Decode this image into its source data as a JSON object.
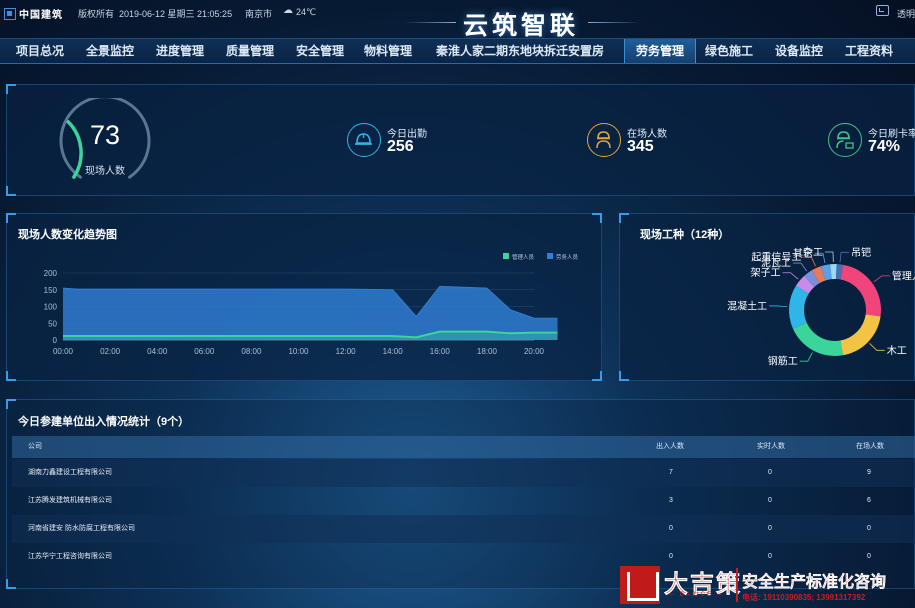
{
  "header": {
    "company": "中国建筑",
    "copyright": "版权所有",
    "datetime": "2019-06-12 星期三 21:05:25",
    "city": "南京市",
    "temperature": "24℃",
    "app_title": "云筑智联",
    "right_label": "透明"
  },
  "nav": {
    "items": [
      "项目总况",
      "全景监控",
      "进度管理",
      "质量管理",
      "安全管理",
      "物料管理"
    ],
    "project": "秦淮人家二期东地块拆迁安置房",
    "active": "劳务管理",
    "items_right": [
      "绿色施工",
      "设备监控",
      "工程资料"
    ]
  },
  "summary": {
    "onsite_count": "73",
    "onsite_label": "现场人数",
    "onsite_ratio": 0.29,
    "stats": [
      {
        "label": "今日出勤",
        "value": "256",
        "color": "#2fb5e8",
        "icon": "helmet-icon"
      },
      {
        "label": "在场人数",
        "value": "345",
        "color": "#e8a53a",
        "icon": "worker-icon"
      },
      {
        "label": "今日刷卡率",
        "value": "74%",
        "color": "#3cc48a",
        "icon": "card-worker-icon"
      }
    ]
  },
  "trend": {
    "title": "现场人数变化趋势图"
  },
  "chart_data": [
    {
      "type": "area",
      "title": "现场人数变化趋势图",
      "x": [
        "00:00",
        "02:00",
        "04:00",
        "06:00",
        "08:00",
        "10:00",
        "12:00",
        "14:00",
        "16:00",
        "18:00",
        "20:00"
      ],
      "ylim": [
        0,
        200
      ],
      "yticks": [
        0,
        50,
        100,
        150,
        200
      ],
      "legend": {
        "position": "top-right"
      },
      "series": [
        {
          "name": "管理人员",
          "color": "#3bd49a",
          "points": [
            [
              0,
              12
            ],
            [
              1,
              12
            ],
            [
              2,
              12
            ],
            [
              3,
              12
            ],
            [
              4,
              12
            ],
            [
              5,
              12
            ],
            [
              6,
              12
            ],
            [
              7,
              12
            ],
            [
              7.5,
              8
            ],
            [
              8,
              25
            ],
            [
              9,
              25
            ],
            [
              9.5,
              20
            ],
            [
              10,
              22
            ],
            [
              10.5,
              22
            ]
          ]
        },
        {
          "name": "劳务人员",
          "color": "#2f7fd6",
          "points": [
            [
              0,
              155
            ],
            [
              0.3,
              152
            ],
            [
              1,
              152
            ],
            [
              2,
              152
            ],
            [
              3,
              152
            ],
            [
              4,
              152
            ],
            [
              5,
              152
            ],
            [
              6,
              152
            ],
            [
              7,
              150
            ],
            [
              7.5,
              70
            ],
            [
              8,
              160
            ],
            [
              9,
              155
            ],
            [
              9.5,
              90
            ],
            [
              10,
              65
            ],
            [
              10.5,
              65
            ]
          ]
        }
      ]
    },
    {
      "type": "pie",
      "title": "现场工种（12种）",
      "slices": [
        {
          "label": "管理人员",
          "value": 22,
          "color": "#f0447a"
        },
        {
          "label": "木工",
          "value": 18,
          "color": "#f3c343"
        },
        {
          "label": "钢筋工",
          "value": 19,
          "color": "#3bd49a"
        },
        {
          "label": "混凝土工",
          "value": 14,
          "color": "#2fb5e8"
        },
        {
          "label": "架子工",
          "value": 4,
          "color": "#c78be8"
        },
        {
          "label": "泥瓦工",
          "value": 3,
          "color": "#7a8fd9"
        },
        {
          "label": "起重信号工",
          "value": 3,
          "color": "#e87a5a"
        },
        {
          "label": "其它",
          "value": 3,
          "color": "#5aa0e8"
        },
        {
          "label": "杂工",
          "value": 2,
          "color": "#9ad9f0"
        },
        {
          "label": "吊钯",
          "value": 2,
          "color": "#4a6fb5"
        }
      ]
    }
  ],
  "worktype": {
    "title": "现场工种（12种）"
  },
  "table": {
    "title": "今日参建单位出入情况统计（9个）",
    "headers": [
      "公司",
      "出入人数",
      "实时人数",
      "在场人数"
    ],
    "rows": [
      [
        "湖南力鑫建设工程有限公司",
        "7",
        "0",
        "9"
      ],
      [
        "江苏腾发建筑机械有限公司",
        "3",
        "0",
        "6"
      ],
      [
        "河南省建安 防水防腐工程有限公司",
        "0",
        "0",
        "0"
      ],
      [
        "江苏华宁工程咨询有限公司",
        "0",
        "0",
        "0"
      ]
    ]
  },
  "watermark": {
    "brand": "大吉策",
    "brand_en": "— DAJICE —",
    "slogan": "安全生产标准化咨询",
    "phone": "电话: 19110390835; 13991317392"
  }
}
